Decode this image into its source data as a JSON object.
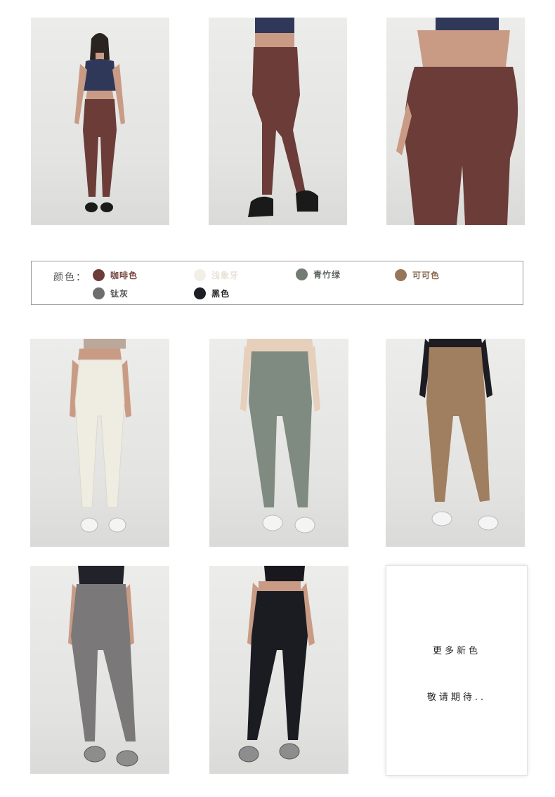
{
  "legend": {
    "title": "颜色：",
    "colors": [
      {
        "name": "咖啡色",
        "swatch": "#6b3c38",
        "text_color": "#7a4a44"
      },
      {
        "name": "浅象牙",
        "swatch": "#f2efe6",
        "text_color": "#e6e2d6"
      },
      {
        "name": "青竹绿",
        "swatch": "#737c74",
        "text_color": "#5f6660"
      },
      {
        "name": "可可色",
        "swatch": "#967558",
        "text_color": "#8a6a50"
      },
      {
        "name": "钛灰",
        "swatch": "#6f6d70",
        "text_color": "#555"
      },
      {
        "name": "黑色",
        "swatch": "#1d1e24",
        "text_color": "#222"
      }
    ]
  },
  "photos": [
    {
      "name": "coffee-full-body-photo",
      "legging_color": "#6b3c38",
      "top_color": "#2f3858"
    },
    {
      "name": "coffee-side-photo",
      "legging_color": "#6b3c38",
      "top_color": "#2f3858"
    },
    {
      "name": "coffee-back-photo",
      "legging_color": "#6b3c38",
      "top_color": "#2f3858"
    },
    {
      "name": "ivory-legging-photo",
      "legging_color": "#efece2",
      "top_color": "#bca89a"
    },
    {
      "name": "bamboo-green-legging-photo",
      "legging_color": "#7f8b80",
      "top_color": "#e6cfbb"
    },
    {
      "name": "cocoa-legging-photo",
      "legging_color": "#a07e60",
      "top_color": "#1c1c22"
    },
    {
      "name": "titanium-grey-legging-photo",
      "legging_color": "#7a7879",
      "top_color": "#22222a"
    },
    {
      "name": "black-legging-photo",
      "legging_color": "#1b1c22",
      "top_color": "#18181e"
    }
  ],
  "coming_soon": {
    "line1": "更多新色",
    "line2": "敬请期待.."
  }
}
